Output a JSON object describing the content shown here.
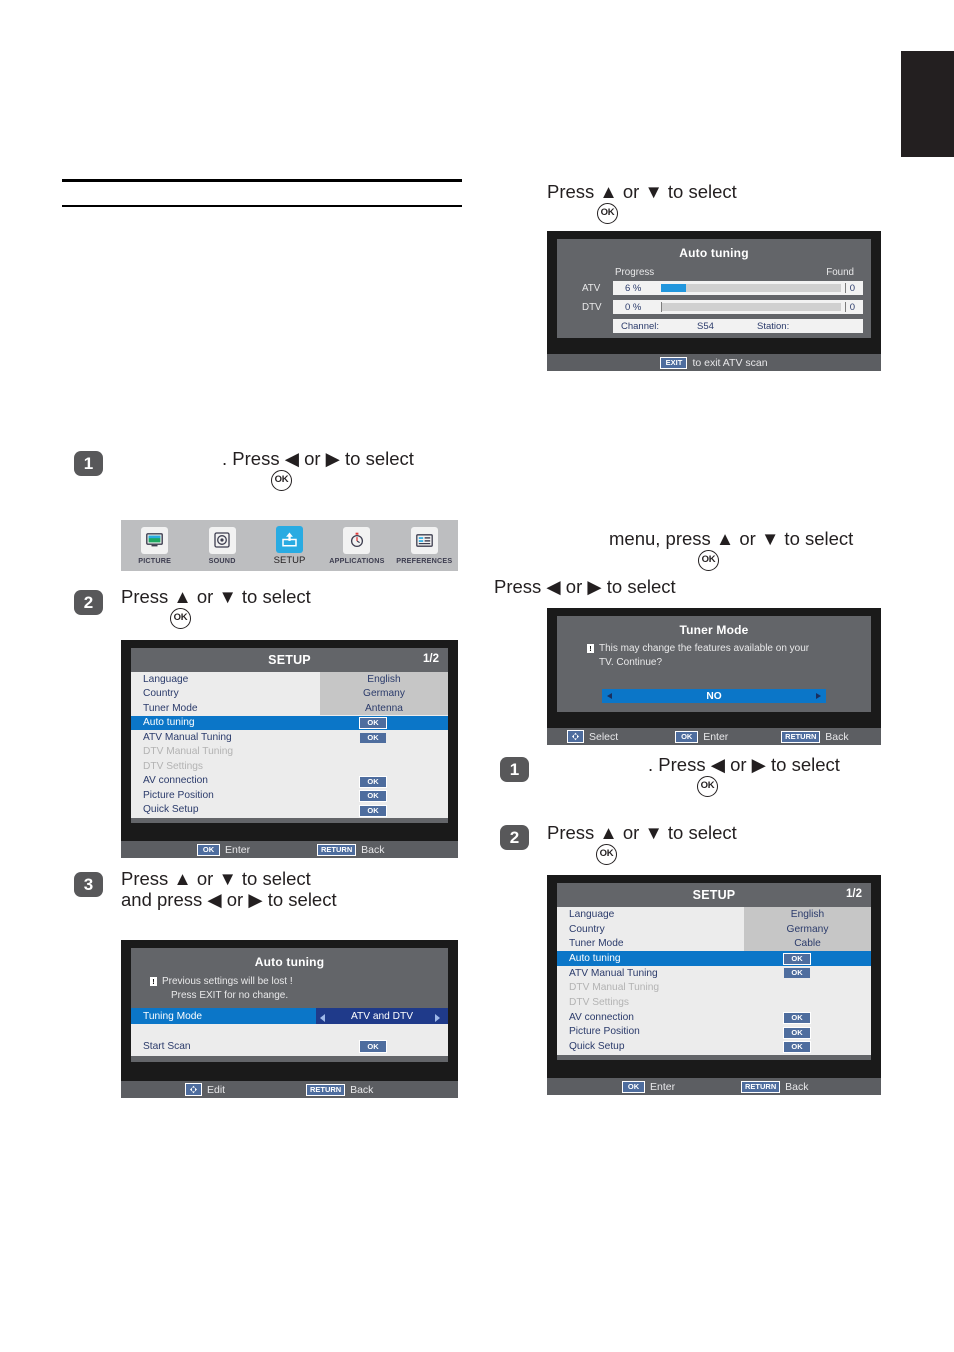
{
  "page": {
    "black_tab": "",
    "rules": 2
  },
  "left_column": {
    "step1": {
      "badge": "1",
      "text": ". Press ◀ or ▶ to select",
      "ok": "OK"
    },
    "icon_bar": {
      "items": [
        {
          "label": "PICTURE",
          "icon": "monitor-icon",
          "active": false
        },
        {
          "label": "SOUND",
          "icon": "speaker-icon",
          "active": false
        },
        {
          "label": "SETUP",
          "icon": "setup-arrow-icon",
          "active": true
        },
        {
          "label": "APPLICATIONS",
          "icon": "stopwatch-icon",
          "active": false
        },
        {
          "label": "PREFERENCES",
          "icon": "list-card-icon",
          "active": false
        }
      ],
      "accent": "#29abe2"
    },
    "step2": {
      "badge": "2",
      "text": "Press ▲ or ▼ to select",
      "ok": "OK"
    },
    "setup_panel": {
      "title": "SETUP",
      "page_indicator": "1/2",
      "rows": [
        {
          "label": "Language",
          "value": "English",
          "type": "value",
          "state": "normal"
        },
        {
          "label": "Country",
          "value": "Germany",
          "type": "value",
          "state": "normal"
        },
        {
          "label": "Tuner Mode",
          "value": "Antenna",
          "type": "value",
          "state": "normal"
        },
        {
          "label": "Auto tuning",
          "value": "OK",
          "type": "ok",
          "state": "selected"
        },
        {
          "label": "ATV Manual Tuning",
          "value": "OK",
          "type": "ok",
          "state": "normal"
        },
        {
          "label": "DTV Manual Tuning",
          "value": "",
          "type": "none",
          "state": "disabled"
        },
        {
          "label": "DTV Settings",
          "value": "",
          "type": "none",
          "state": "disabled"
        },
        {
          "label": "AV connection",
          "value": "OK",
          "type": "ok",
          "state": "normal"
        },
        {
          "label": "Picture Position",
          "value": "OK",
          "type": "ok",
          "state": "normal"
        },
        {
          "label": "Quick Setup",
          "value": "OK",
          "type": "ok",
          "state": "normal"
        }
      ],
      "footer": {
        "ok_key": "OK",
        "ok_label": "Enter",
        "return_key": "RETURN",
        "return_label": "Back"
      }
    },
    "step3": {
      "badge": "3",
      "line1": "Press ▲ or ▼ to select",
      "line2": "and press ◀ or ▶ to select"
    },
    "auto_tuning_dialog": {
      "title": "Auto tuning",
      "warn_icon": "!",
      "warn_line1": "Previous settings will be lost !",
      "warn_line2": "Press EXIT for no change.",
      "rows": [
        {
          "label": "Tuning Mode",
          "value": "ATV and DTV",
          "type": "spinner",
          "state": "selected"
        },
        {
          "label": "Start Scan",
          "value": "OK",
          "type": "ok",
          "state": "normal"
        }
      ],
      "footer": {
        "dpad_key": "dpad",
        "dpad_label": "Edit",
        "return_key": "RETURN",
        "return_label": "Back"
      }
    }
  },
  "right_column": {
    "top_instruction": {
      "text": "Press ▲ or ▼ to select",
      "ok": "OK"
    },
    "auto_tuning_progress": {
      "title": "Auto tuning",
      "progress_header": "Progress",
      "found_header": "Found",
      "rows": [
        {
          "name": "ATV",
          "percent": "6  %",
          "percent_value": 6,
          "found": "0"
        },
        {
          "name": "DTV",
          "percent": "0  %",
          "percent_value": 0,
          "found": "0"
        }
      ],
      "channel_label": "Channel:",
      "channel_value": "S54",
      "station_label": "Station:",
      "station_value": "",
      "footer": {
        "exit_key": "EXIT",
        "exit_label": "to exit ATV scan"
      }
    },
    "menu_instruction": {
      "line1": "menu, press ▲ or ▼ to select",
      "ok": "OK",
      "line2": "Press ◀ or ▶ to select"
    },
    "tuner_mode_dialog": {
      "title": "Tuner Mode",
      "warn_icon": "!",
      "warn_line1": "This may change the features available on your",
      "warn_line2": "TV. Continue?",
      "selector_value": "NO",
      "footer": {
        "dpad_label": "Select",
        "ok_key": "OK",
        "ok_label": "Enter",
        "return_key": "RETURN",
        "return_label": "Back"
      }
    },
    "step1": {
      "badge": "1",
      "text": ". Press ◀ or ▶ to select",
      "ok": "OK"
    },
    "step2": {
      "badge": "2",
      "text": "Press ▲ or ▼ to select",
      "ok": "OK"
    },
    "setup_panel": {
      "title": "SETUP",
      "page_indicator": "1/2",
      "rows": [
        {
          "label": "Language",
          "value": "English",
          "type": "value",
          "state": "normal"
        },
        {
          "label": "Country",
          "value": "Germany",
          "type": "value",
          "state": "normal"
        },
        {
          "label": "Tuner Mode",
          "value": "Cable",
          "type": "value",
          "state": "normal"
        },
        {
          "label": "Auto tuning",
          "value": "OK",
          "type": "ok",
          "state": "selected"
        },
        {
          "label": "ATV Manual Tuning",
          "value": "OK",
          "type": "ok",
          "state": "normal"
        },
        {
          "label": "DTV Manual Tuning",
          "value": "",
          "type": "none",
          "state": "disabled"
        },
        {
          "label": "DTV Settings",
          "value": "",
          "type": "none",
          "state": "disabled"
        },
        {
          "label": "AV connection",
          "value": "OK",
          "type": "ok",
          "state": "normal"
        },
        {
          "label": "Picture Position",
          "value": "OK",
          "type": "ok",
          "state": "normal"
        },
        {
          "label": "Quick Setup",
          "value": "OK",
          "type": "ok",
          "state": "normal"
        }
      ],
      "footer": {
        "ok_key": "OK",
        "ok_label": "Enter",
        "return_key": "RETURN",
        "return_label": "Back"
      }
    }
  }
}
